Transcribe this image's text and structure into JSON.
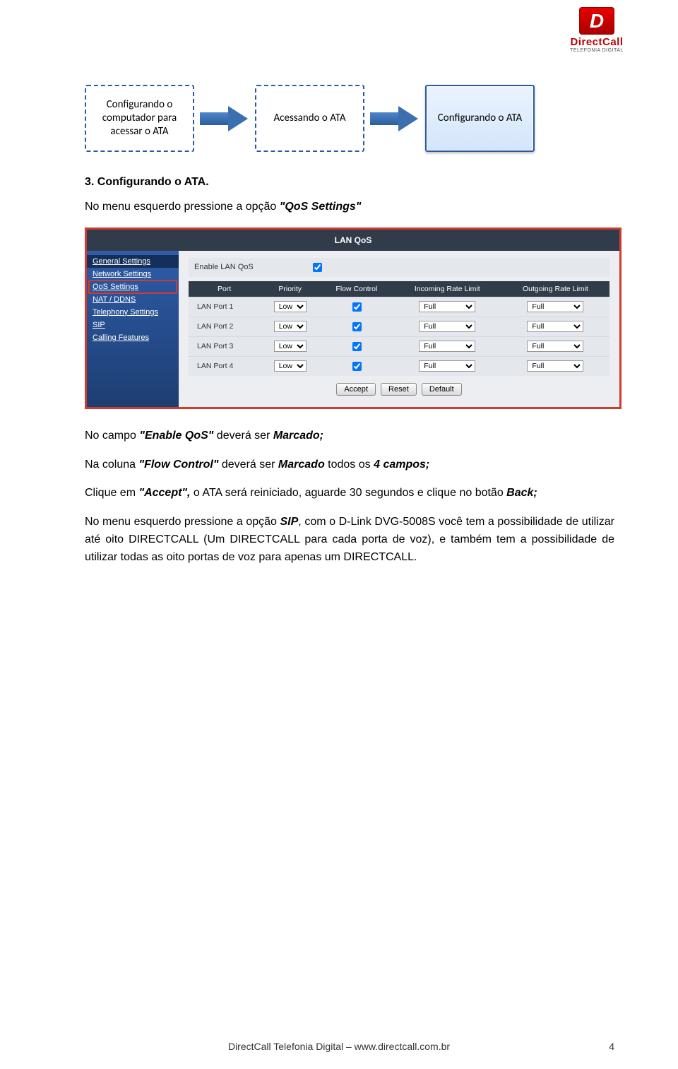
{
  "logo": {
    "brand": "DirectCall",
    "tagline": "TELEFONIA DIGITAL"
  },
  "flow": {
    "box1": "Configurando o computador para acessar o ATA",
    "box2": "Acessando o ATA",
    "box3": "Configurando o ATA"
  },
  "section_title": "3. Configurando o ATA.",
  "para1_prefix": "No menu esquerdo pressione a opção ",
  "para1_quoted": "\"QoS Settings\"",
  "screenshot": {
    "title": "LAN QoS",
    "nav": [
      "General Settings",
      "Network Settings",
      "QoS Settings",
      "NAT / DDNS",
      "Telephony Settings",
      "SIP",
      "Calling Features"
    ],
    "enable_label": "Enable LAN QoS",
    "enable_checked": true,
    "columns": [
      "Port",
      "Priority",
      "Flow Control",
      "Incoming Rate Limit",
      "Outgoing Rate Limit"
    ],
    "rows": [
      {
        "port": "LAN Port 1",
        "priority": "Low",
        "flow": true,
        "in": "Full",
        "out": "Full"
      },
      {
        "port": "LAN Port 2",
        "priority": "Low",
        "flow": true,
        "in": "Full",
        "out": "Full"
      },
      {
        "port": "LAN Port 3",
        "priority": "Low",
        "flow": true,
        "in": "Full",
        "out": "Full"
      },
      {
        "port": "LAN Port 4",
        "priority": "Low",
        "flow": true,
        "in": "Full",
        "out": "Full"
      }
    ],
    "buttons": {
      "accept": "Accept",
      "reset": "Reset",
      "default": "Default"
    }
  },
  "para2": {
    "t1": "No campo ",
    "q1": "\"Enable QoS\"",
    "t2": " deverá ser ",
    "b1": "Marcado;"
  },
  "para3": {
    "t1": "Na coluna ",
    "q1": "\"Flow Control\"",
    "t2": " deverá ser ",
    "b1": "Marcado",
    "t3": " todos os ",
    "b2": "4 campos;"
  },
  "para4": {
    "t1": "Clique em ",
    "q1": "\"Accept\",",
    "t2": " o ATA será reiniciado, aguarde 30 segundos e clique no botão ",
    "b1": "Back;"
  },
  "para5": {
    "t1": "No menu esquerdo pressione a opção ",
    "b1": "SIP",
    "t2": ", com o D-Link DVG-5008S você tem a possibilidade de utilizar até oito DIRECTCALL (Um DIRECTCALL para cada porta de voz), e também tem a possibilidade de utilizar todas as oito portas de voz para apenas um DIRECTCALL."
  },
  "footer": "DirectCall Telefonia Digital – www.directcall.com.br",
  "page_number": "4"
}
